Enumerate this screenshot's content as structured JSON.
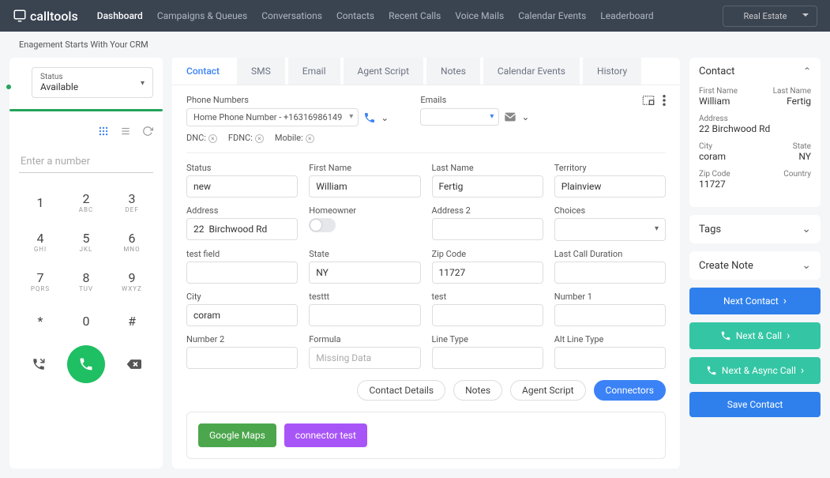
{
  "brand": "calltools",
  "subhead": "Enagement Starts With Your CRM",
  "top_dropdown": "Real Estate",
  "nav": [
    "Dashboard",
    "Campaigns & Queues",
    "Conversations",
    "Contacts",
    "Recent Calls",
    "Voice Mails",
    "Calendar Events",
    "Leaderboard"
  ],
  "nav_active": 0,
  "left": {
    "status_label": "Status",
    "status_value": "Available",
    "phone_placeholder": "Enter a number",
    "keys": [
      {
        "d": "1",
        "l": ""
      },
      {
        "d": "2",
        "l": "ABC"
      },
      {
        "d": "3",
        "l": "DEF"
      },
      {
        "d": "4",
        "l": "GHI"
      },
      {
        "d": "5",
        "l": "JKL"
      },
      {
        "d": "6",
        "l": "MNO"
      },
      {
        "d": "7",
        "l": "PQRS"
      },
      {
        "d": "8",
        "l": "TUV"
      },
      {
        "d": "9",
        "l": "WXYZ"
      },
      {
        "d": "*",
        "l": ""
      },
      {
        "d": "0",
        "l": ""
      },
      {
        "d": "#",
        "l": ""
      }
    ]
  },
  "center": {
    "tabs": [
      "Contact",
      "SMS",
      "Email",
      "Agent Script",
      "Notes",
      "Calendar Events",
      "History"
    ],
    "tab_active": 0,
    "phone_label": "Phone Numbers",
    "email_label": "Emails",
    "phone_select": "Home Phone Number - +16316986149",
    "dnc": {
      "dnc": "DNC:",
      "fdnc": "FDNC:",
      "mobile": "Mobile:"
    },
    "fields": {
      "status": {
        "lbl": "Status",
        "val": "new"
      },
      "first_name": {
        "lbl": "First Name",
        "val": "William"
      },
      "last_name": {
        "lbl": "Last Name",
        "val": "Fertig"
      },
      "territory": {
        "lbl": "Territory",
        "val": "Plainview"
      },
      "address": {
        "lbl": "Address",
        "val": "22  Birchwood Rd"
      },
      "homeowner": {
        "lbl": "Homeowner"
      },
      "address2": {
        "lbl": "Address 2",
        "val": ""
      },
      "choices": {
        "lbl": "Choices"
      },
      "test_field": {
        "lbl": "test field",
        "val": ""
      },
      "state": {
        "lbl": "State",
        "val": "NY"
      },
      "zip": {
        "lbl": "Zip Code",
        "val": "11727"
      },
      "last_call": {
        "lbl": "Last Call Duration",
        "val": ""
      },
      "city": {
        "lbl": "City",
        "val": "coram"
      },
      "testtt": {
        "lbl": "testtt",
        "val": ""
      },
      "test": {
        "lbl": "test",
        "val": ""
      },
      "number1": {
        "lbl": "Number 1",
        "val": ""
      },
      "number2": {
        "lbl": "Number 2",
        "val": ""
      },
      "formula": {
        "lbl": "Formula",
        "ph": "Missing Data"
      },
      "line_type": {
        "lbl": "Line Type",
        "val": ""
      },
      "alt_line": {
        "lbl": "Alt Line Type",
        "val": ""
      }
    },
    "pills": {
      "details": "Contact Details",
      "notes": "Notes",
      "script": "Agent Script",
      "connectors": "Connectors"
    },
    "connectors": {
      "gmaps": "Google Maps",
      "ctest": "connector test"
    }
  },
  "right": {
    "contact_header": "Contact",
    "first_name": {
      "lbl": "First Name",
      "val": "William"
    },
    "last_name": {
      "lbl": "Last Name",
      "val": "Fertig"
    },
    "address": {
      "lbl": "Address",
      "val": "22 Birchwood Rd"
    },
    "city": {
      "lbl": "City",
      "val": "coram"
    },
    "state": {
      "lbl": "State",
      "val": "NY"
    },
    "zip": {
      "lbl": "Zip Code",
      "val": "11727"
    },
    "country": {
      "lbl": "Country",
      "val": ""
    },
    "tags_header": "Tags",
    "note_header": "Create Note",
    "btn_next": "Next Contact",
    "btn_call": "Next & Call",
    "btn_async": "Next & Async Call",
    "btn_save": "Save Contact"
  }
}
